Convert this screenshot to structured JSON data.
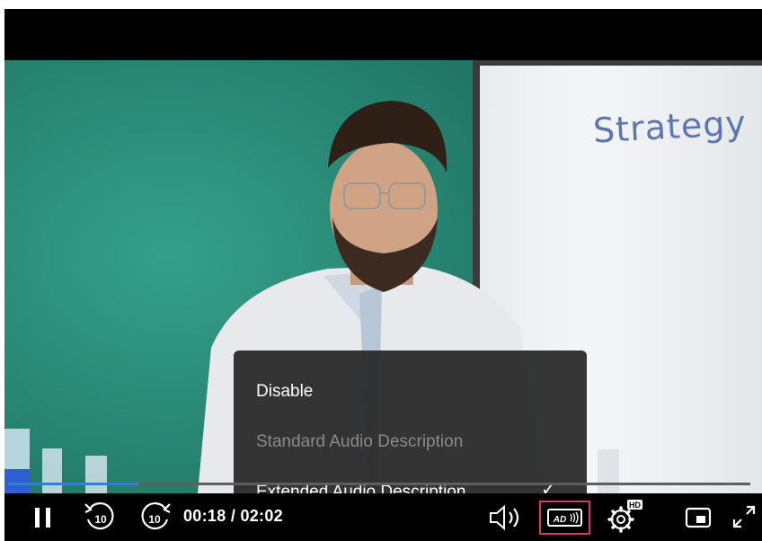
{
  "video": {
    "board_text": "Strategy",
    "progress_fraction": 0.176
  },
  "audio_description_menu": {
    "items": [
      {
        "label": "Disable",
        "state": "enabled"
      },
      {
        "label": "Standard Audio Description",
        "state": "disabled"
      },
      {
        "label": "Extended Audio Description",
        "state": "selected"
      }
    ],
    "check_glyph": "✓"
  },
  "controls": {
    "time_display": "00:18 / 02:02",
    "rewind_seconds": "10",
    "forward_seconds": "10",
    "ad_label": "AD",
    "hd_badge": "HD",
    "icons": {
      "play_pause": "pause-icon",
      "rewind": "rewind-10-icon",
      "forward": "forward-10-icon",
      "volume": "volume-icon",
      "audio_description": "audio-description-icon",
      "settings": "settings-gear-icon",
      "pip": "picture-in-picture-icon",
      "fullscreen": "fullscreen-icon"
    }
  },
  "colors": {
    "accent_progress": "#2f7fd8",
    "highlight_border": "#e0356e",
    "menu_bg": "#282828",
    "screen_green": "#2a8b77"
  }
}
